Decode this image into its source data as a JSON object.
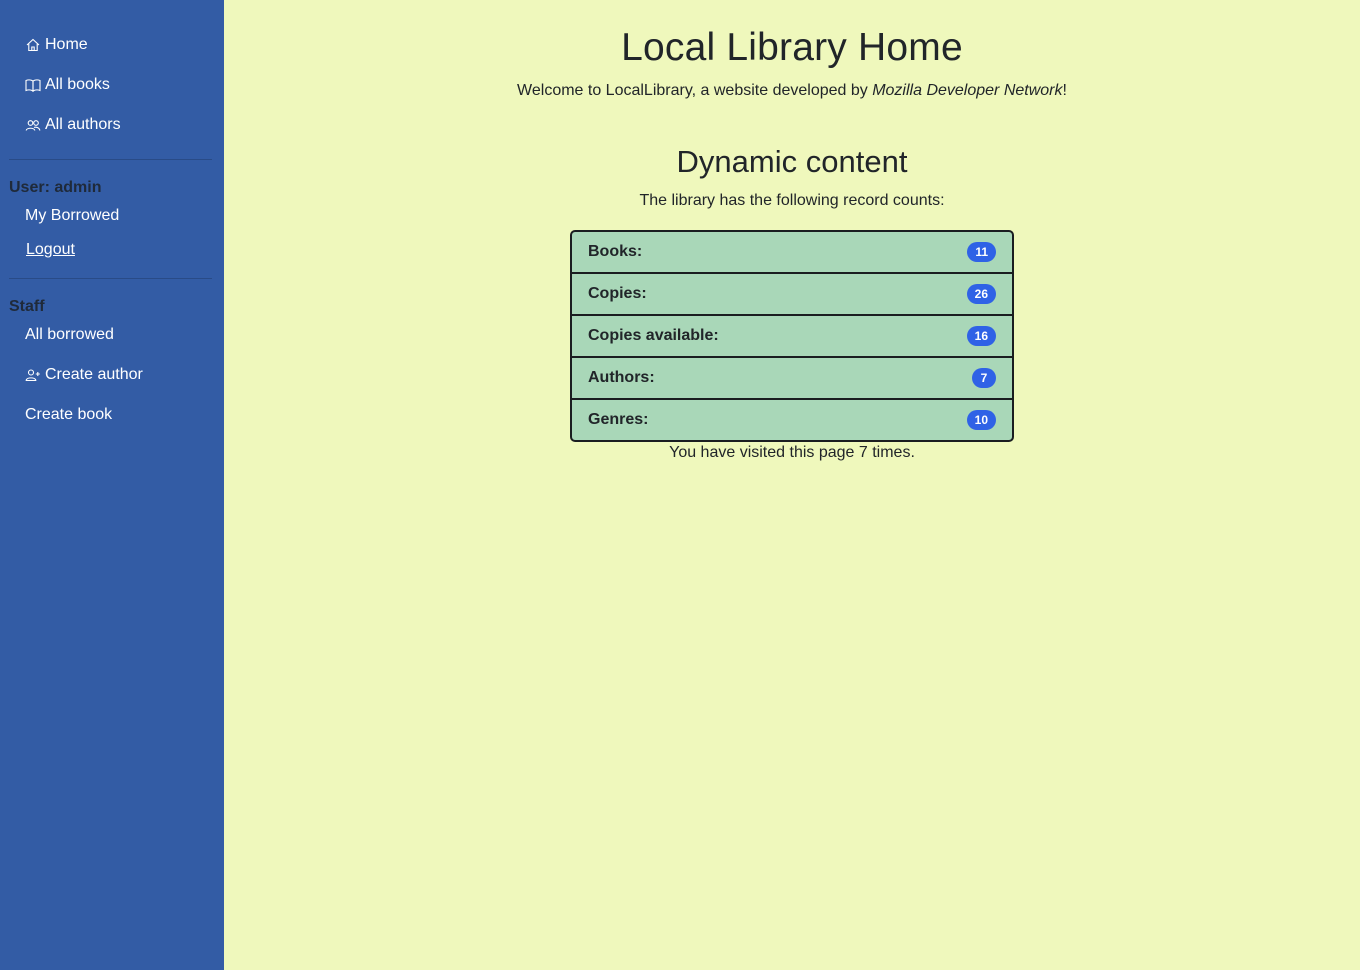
{
  "sidebar": {
    "nav": [
      {
        "label": "Home",
        "icon": "house-icon"
      },
      {
        "label": "All books",
        "icon": "open-book-icon"
      },
      {
        "label": "All authors",
        "icon": "people-icon"
      }
    ],
    "user_heading": "User: admin",
    "user_links": [
      "My Borrowed",
      "Logout"
    ],
    "staff_heading": "Staff",
    "staff_links": [
      {
        "label": "All borrowed"
      },
      {
        "label": "Create author",
        "icon": "person-plus-icon"
      },
      {
        "label": "Create book"
      }
    ]
  },
  "main": {
    "title": "Local Library Home",
    "welcome_prefix": "Welcome to LocalLibrary, a website developed by ",
    "welcome_org": "Mozilla Developer Network",
    "welcome_suffix": "!",
    "dynamic_title": "Dynamic content",
    "intro": "The library has the following record counts:",
    "counts": [
      {
        "label": "Books:",
        "value": "11"
      },
      {
        "label": "Copies:",
        "value": "26"
      },
      {
        "label": "Copies available:",
        "value": "16"
      },
      {
        "label": "Authors:",
        "value": "7"
      },
      {
        "label": "Genres:",
        "value": "10"
      }
    ],
    "visits": "You have visited this page 7 times."
  },
  "colors": {
    "sidebar_bg": "#335ca5",
    "main_bg": "#eff8bc",
    "table_bg": "#a9d7b8",
    "badge_bg": "#2f62e6"
  }
}
